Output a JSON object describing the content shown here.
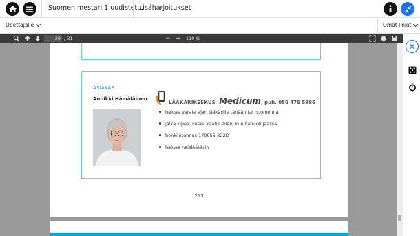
{
  "header": {
    "book_title": "Suomen mestari 1 uudistettu",
    "section_title": "Lisäharjoitukset"
  },
  "subbar": {
    "teacher_label": "Opettajalle",
    "own_links_label": "Omat linkit"
  },
  "pdf_toolbar": {
    "current_page": "29",
    "total_pages": "/ 31",
    "zoom_minus": "−",
    "zoom_plus": "+",
    "zoom_level": "110 %"
  },
  "document": {
    "customer_label": "ASIAKAS",
    "customer_name": "Annikki Hämäläinen",
    "clinic_prefix": "LÄÄKÄRIKESKUS",
    "clinic_brand": "Medicum",
    "clinic_phone": ", puh. 050 476 5986",
    "notes": [
      "haluaa varata ajan lääkärille tänään tai huomenna",
      "jalka kipeä, koska kaatui eilen, kun katu oli jäässä",
      "henkilötunnus 170955-322D",
      "haluaa naislääkärin"
    ],
    "page_number": "213"
  },
  "colors": {
    "accent": "#00a3dc",
    "frame": "#6ccbe7",
    "help_button": "#1a73e8",
    "toolbar": "#3a3a3a"
  },
  "icons": [
    "home-icon",
    "menu-icon",
    "info-icon",
    "collapse-icon",
    "search-icon",
    "arrow-up-icon",
    "arrow-down-icon",
    "fullscreen-icon",
    "print-icon",
    "save-icon",
    "close-icon",
    "dice-icon",
    "stopwatch-icon",
    "phone-icon"
  ]
}
